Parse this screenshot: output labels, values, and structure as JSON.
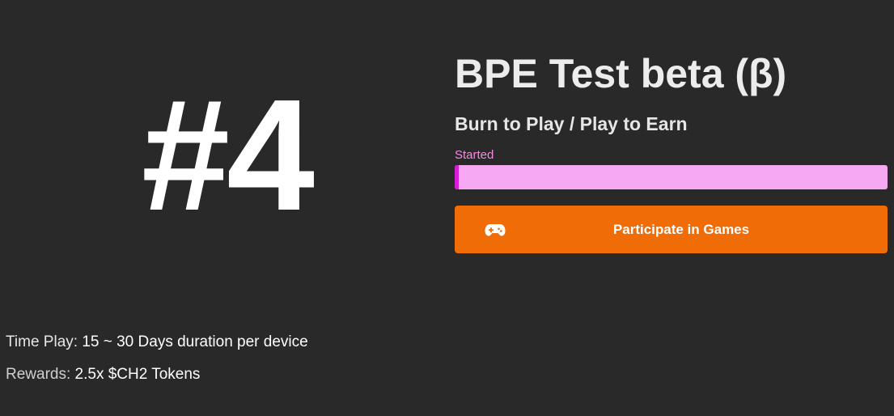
{
  "rank": {
    "label": "#4"
  },
  "game": {
    "title": "BPE Test beta (β)",
    "subtitle": "Burn to Play / Play to Earn"
  },
  "status": {
    "label": "Started",
    "progress_fraction": 0.01
  },
  "actions": {
    "participate_label": "Participate in Games",
    "participate_icon": "gamepad-icon"
  },
  "details": {
    "time_play_label": "Time Play:",
    "time_play_value": "15 ~ 30 Days duration per device",
    "rewards_label": "Rewards:",
    "rewards_value": "2.5x $CH2 Tokens"
  },
  "colors": {
    "background": "#292929",
    "progress_track": "#f7a8f3",
    "progress_fill": "#d81bd8",
    "status_text": "#f58be0",
    "button": "#ef6c06"
  }
}
